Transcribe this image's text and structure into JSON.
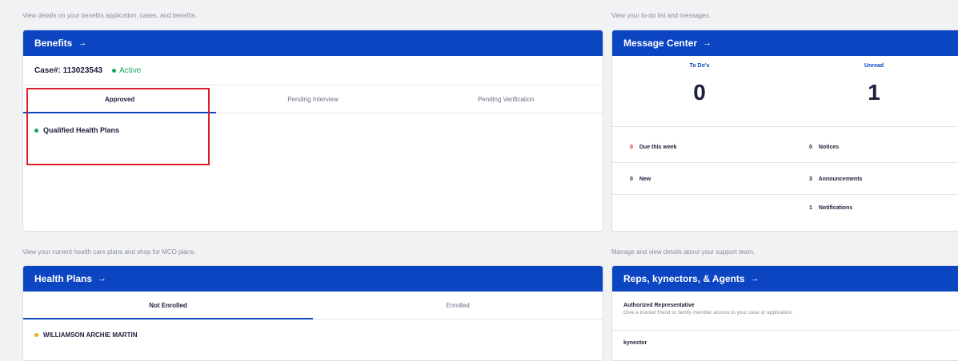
{
  "captions": {
    "benefits": "View details on your benefits application, cases, and benefits.",
    "messages": "View your to-do list and messages.",
    "health_plans": "View your current health care plans and shop for MCO plans.",
    "support": "Manage and view details about your support team."
  },
  "benefits": {
    "title": "Benefits",
    "arrow": "→",
    "case_label": "Case#: 113023543",
    "status": "Active",
    "tabs": [
      "Approved",
      "Pending Interview",
      "Pending Verification"
    ],
    "active_tab": "Approved",
    "plans": [
      "Qualified Health Plans"
    ]
  },
  "message_center": {
    "title": "Message Center",
    "arrow": "→",
    "columns": [
      {
        "label": "To Do's",
        "value": "0"
      },
      {
        "label": "Unread",
        "value": "1"
      }
    ],
    "stats": {
      "due_this_week": {
        "count": "0",
        "label": "Due this week"
      },
      "new": {
        "count": "0",
        "label": "New"
      },
      "notices": {
        "count": "0",
        "label": "Notices"
      },
      "announcements": {
        "count": "3",
        "label": "Announcements"
      },
      "notifications": {
        "count": "1",
        "label": "Notifications"
      }
    }
  },
  "health_plans": {
    "title": "Health Plans",
    "arrow": "→",
    "tabs": [
      "Not Enrolled",
      "Enrolled"
    ],
    "active_tab": "Not Enrolled",
    "members": [
      "WILLIAMSON ARCHIE MARTIN"
    ]
  },
  "reps": {
    "title": "Reps, kynectors, & Agents",
    "arrow": "→",
    "items": [
      {
        "title": "Authorized Representative",
        "desc": "Give a trusted friend or family member access to your case or application."
      },
      {
        "title": "kynector",
        "desc": ""
      }
    ]
  },
  "colors": {
    "brand_blue": "#0c45c2",
    "active_green": "#1aa260",
    "alert_red": "#d9202a",
    "member_orange": "#f5a623"
  }
}
